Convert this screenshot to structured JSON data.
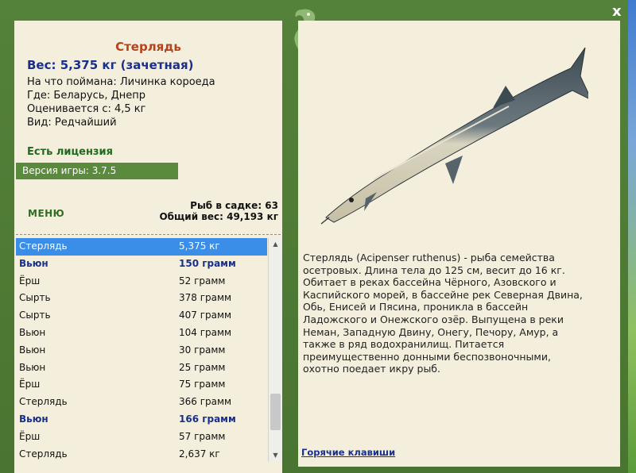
{
  "header": {
    "close_label": "x"
  },
  "fish_card": {
    "name": "Стерлядь",
    "weight_line": "Вес: 5,375 кг (зачетная)",
    "caught_on": "На что поймана: Личинка короеда",
    "where": "Где: Беларусь, Днепр",
    "valued_from": "Оценивается с: 4,5 кг",
    "kind": "Вид: Редчайший"
  },
  "license": "Есть лицензия",
  "version": "Версия игры: 3.7.5",
  "menu_label": "МЕНЮ",
  "stats": {
    "fish_in_cage": "Рыб в садке: 63",
    "total_weight": "Общий вес: 49,193 кг"
  },
  "catch_list": [
    {
      "name": "Стерлядь",
      "weight": "5,375 кг",
      "style": "selected"
    },
    {
      "name": "Вьюн",
      "weight": "150 грамм",
      "style": "bold"
    },
    {
      "name": "Ёрш",
      "weight": "52 грамм",
      "style": "normal"
    },
    {
      "name": "Сырть",
      "weight": "378 грамм",
      "style": "normal"
    },
    {
      "name": "Сырть",
      "weight": "407 грамм",
      "style": "normal"
    },
    {
      "name": "Вьюн",
      "weight": "104 грамм",
      "style": "normal"
    },
    {
      "name": "Вьюн",
      "weight": "30 грамм",
      "style": "normal"
    },
    {
      "name": "Вьюн",
      "weight": "25 грамм",
      "style": "normal"
    },
    {
      "name": "Ёрш",
      "weight": "75 грамм",
      "style": "normal"
    },
    {
      "name": "Стерлядь",
      "weight": "366 грамм",
      "style": "normal"
    },
    {
      "name": "Вьюн",
      "weight": "166 грамм",
      "style": "bold"
    },
    {
      "name": "Ёрш",
      "weight": "57 грамм",
      "style": "normal"
    },
    {
      "name": "Стерлядь",
      "weight": "2,637 кг",
      "style": "normal"
    }
  ],
  "description": "Стерлядь (Acipenser ruthenus) - рыба семейства осетровых. Длина тела до 125 см, весит до 16 кг. Обитает в реках бассейна Чёрного, Азовского и Каспийского морей, в бассейне рек Северная Двина, Обь, Енисей и Пясина, проникла в бассейн Ладожского и Онежского озёр. Выпущена в реки Неман, Западную Двину, Онегу, Печору, Амур, а также в ряд водохранилищ. Питается преимущественно донными беспозвоночными, охотно поедает икру рыб.",
  "hotkeys_label": "Горячие клавиши",
  "icons": {
    "logo": "fish-logo-icon",
    "close": "close-icon",
    "scroll_up": "arrow-up-icon",
    "scroll_down": "arrow-down-icon"
  }
}
